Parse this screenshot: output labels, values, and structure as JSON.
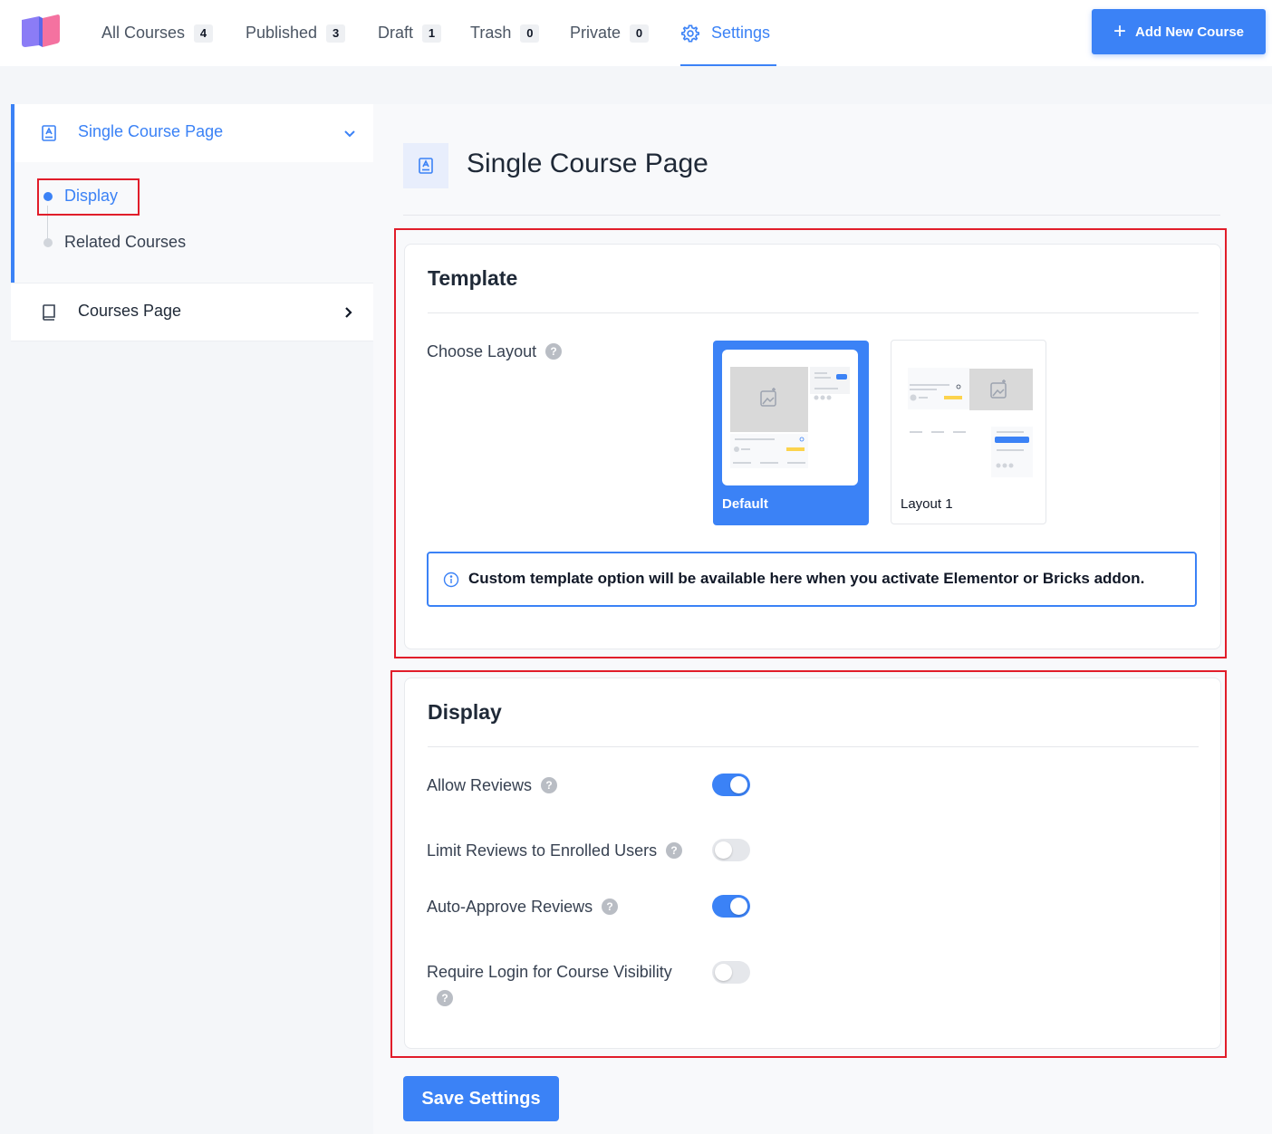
{
  "topbar": {
    "nav": [
      {
        "label": "All Courses",
        "count": "4"
      },
      {
        "label": "Published",
        "count": "3"
      },
      {
        "label": "Draft",
        "count": "1"
      },
      {
        "label": "Trash",
        "count": "0"
      },
      {
        "label": "Private",
        "count": "0"
      },
      {
        "label": "Settings",
        "count": null
      }
    ],
    "active_tab": "Settings",
    "add_button_label": "Add New Course"
  },
  "sidebar": {
    "group_single": {
      "label": "Single Course Page",
      "expanded": true,
      "items": [
        {
          "label": "Display",
          "active": true
        },
        {
          "label": "Related Courses",
          "active": false
        }
      ]
    },
    "group_courses": {
      "label": "Courses Page",
      "expanded": false
    }
  },
  "main": {
    "page_title": "Single Course Page",
    "template_card": {
      "title": "Template",
      "choose_layout_label": "Choose Layout",
      "layouts": [
        {
          "label": "Default",
          "selected": true
        },
        {
          "label": "Layout 1",
          "selected": false
        }
      ],
      "notice": "Custom template option will be available here when you activate Elementor or Bricks addon."
    },
    "display_card": {
      "title": "Display",
      "settings": [
        {
          "label": "Allow Reviews",
          "enabled": true
        },
        {
          "label": "Limit Reviews to Enrolled Users",
          "enabled": false
        },
        {
          "label": "Auto-Approve Reviews",
          "enabled": true
        },
        {
          "label": "Require Login for Course Visibility",
          "enabled": false
        }
      ]
    },
    "save_button_label": "Save Settings"
  },
  "colors": {
    "accent": "#3b82f6",
    "annotation_red": "#e11d2a",
    "toggle_off": "#e5e7eb"
  },
  "icons": {
    "logo": "book-logo-icon",
    "settings": "gear-icon",
    "add": "plus-icon",
    "single_course": "user-card-icon",
    "courses_page": "book-icon",
    "expand": "chevron-down-icon",
    "collapsed": "chevron-right-icon",
    "help": "question-circle-icon",
    "info": "info-circle-icon"
  }
}
